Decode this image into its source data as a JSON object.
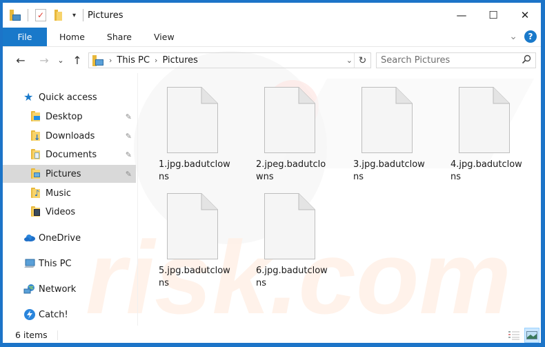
{
  "window": {
    "title": "Pictures",
    "border_color": "#1c74c8",
    "accent": "#1979ca",
    "minimize_glyph": "—",
    "maximize_glyph": "☐",
    "close_glyph": "✕"
  },
  "ribbon": {
    "tabs": [
      {
        "label": "File",
        "active": true
      },
      {
        "label": "Home"
      },
      {
        "label": "Share"
      },
      {
        "label": "View"
      }
    ],
    "expand_glyph": "⌄",
    "help_glyph": "?"
  },
  "navbar": {
    "back_glyph": "←",
    "forward_glyph": "→",
    "recent_glyph": "⌄",
    "up_glyph": "↑",
    "breadcrumb": [
      "This PC",
      "Pictures"
    ],
    "crumb_sep": "›",
    "dropdown_glyph": "⌄",
    "refresh_glyph": "↻",
    "search_placeholder": "Search Pictures",
    "search_glyph": "⚲"
  },
  "sidebar": {
    "quick_access": {
      "label": "Quick access",
      "icon": "star-icon"
    },
    "pinned": [
      {
        "label": "Desktop",
        "icon": "desktop-folder-icon",
        "pinned": true
      },
      {
        "label": "Downloads",
        "icon": "downloads-folder-icon",
        "pinned": true
      },
      {
        "label": "Documents",
        "icon": "documents-folder-icon",
        "pinned": true
      },
      {
        "label": "Pictures",
        "icon": "pictures-folder-icon",
        "pinned": true,
        "selected": true
      },
      {
        "label": "Music",
        "icon": "music-folder-icon",
        "pinned": false
      },
      {
        "label": "Videos",
        "icon": "videos-folder-icon",
        "pinned": false
      }
    ],
    "roots": [
      {
        "label": "OneDrive",
        "icon": "onedrive-icon"
      },
      {
        "label": "This PC",
        "icon": "this-pc-icon"
      },
      {
        "label": "Network",
        "icon": "network-icon"
      },
      {
        "label": "Catch!",
        "icon": "catch-icon"
      }
    ],
    "pin_glyph": "📌"
  },
  "files": [
    {
      "name": "1.jpg.badutclowns"
    },
    {
      "name": "2.jpeg.badutclowns"
    },
    {
      "name": "3.jpg.badutclowns"
    },
    {
      "name": "4.jpg.badutclowns"
    },
    {
      "name": "5.jpg.badutclowns"
    },
    {
      "name": "6.jpg.badutclowns"
    }
  ],
  "status": {
    "item_count": "6 items",
    "active_view": "large-icons"
  }
}
